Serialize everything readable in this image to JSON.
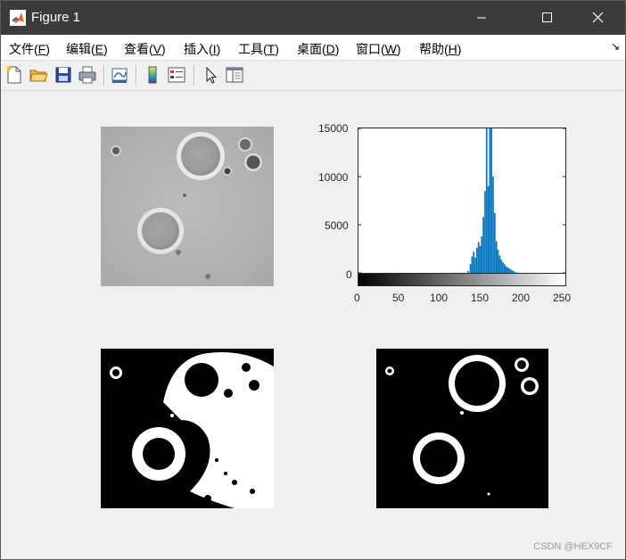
{
  "window": {
    "title": "Figure 1",
    "icon": "matlab-icon",
    "controls": [
      "minimize-icon",
      "maximize-icon",
      "close-icon"
    ]
  },
  "menu": {
    "items": [
      {
        "label": "文件(",
        "key": "F",
        "suffix": ")"
      },
      {
        "label": "编辑(",
        "key": "E",
        "suffix": ")"
      },
      {
        "label": "查看(",
        "key": "V",
        "suffix": ")"
      },
      {
        "label": "插入(",
        "key": "I",
        "suffix": ")"
      },
      {
        "label": "工具(",
        "key": "T",
        "suffix": ")"
      },
      {
        "label": "桌面(",
        "key": "D",
        "suffix": ")"
      },
      {
        "label": "窗口(",
        "key": "W",
        "suffix": ")"
      },
      {
        "label": "帮助(",
        "key": "H",
        "suffix": ")"
      }
    ],
    "overflow_glyph": "↘"
  },
  "toolbar": {
    "icons": [
      "new-figure-icon",
      "open-file-icon",
      "save-icon",
      "print-icon",
      "link-plot-icon",
      "colorbar-icon",
      "legend-icon",
      "pointer-icon",
      "property-editor-icon"
    ]
  },
  "chart_data": {
    "type": "bar",
    "title": "",
    "xlabel": "",
    "ylabel": "",
    "xlim": [
      0,
      255
    ],
    "ylim": [
      0,
      15000
    ],
    "yticks": [
      "15000",
      "10000",
      "5000",
      "0"
    ],
    "xticks": [
      "0",
      "50",
      "100",
      "150",
      "200",
      "250"
    ],
    "colorbar": "grayscale 0–255",
    "bar_color": "#0072bd",
    "bins": [
      {
        "x": 135,
        "y": 200
      },
      {
        "x": 138,
        "y": 900
      },
      {
        "x": 140,
        "y": 1700
      },
      {
        "x": 142,
        "y": 2200
      },
      {
        "x": 144,
        "y": 1600
      },
      {
        "x": 146,
        "y": 2600
      },
      {
        "x": 148,
        "y": 3200
      },
      {
        "x": 150,
        "y": 2800
      },
      {
        "x": 152,
        "y": 3800
      },
      {
        "x": 154,
        "y": 5800
      },
      {
        "x": 156,
        "y": 8500
      },
      {
        "x": 158,
        "y": 15000
      },
      {
        "x": 160,
        "y": 9000
      },
      {
        "x": 162,
        "y": 15000
      },
      {
        "x": 164,
        "y": 15000
      },
      {
        "x": 166,
        "y": 10000
      },
      {
        "x": 168,
        "y": 6200
      },
      {
        "x": 170,
        "y": 3300
      },
      {
        "x": 172,
        "y": 2400
      },
      {
        "x": 174,
        "y": 1800
      },
      {
        "x": 176,
        "y": 1400
      },
      {
        "x": 178,
        "y": 1100
      },
      {
        "x": 180,
        "y": 900
      },
      {
        "x": 182,
        "y": 700
      },
      {
        "x": 184,
        "y": 550
      },
      {
        "x": 186,
        "y": 450
      },
      {
        "x": 188,
        "y": 350
      },
      {
        "x": 190,
        "y": 250
      },
      {
        "x": 192,
        "y": 150
      },
      {
        "x": 195,
        "y": 60
      }
    ]
  },
  "panels": {
    "original": "grayscale-micrograph",
    "binary_raw": "binary-threshold-image",
    "binary_clean": "binary-cleaned-image"
  },
  "watermark": "CSDN @HEX9CF"
}
